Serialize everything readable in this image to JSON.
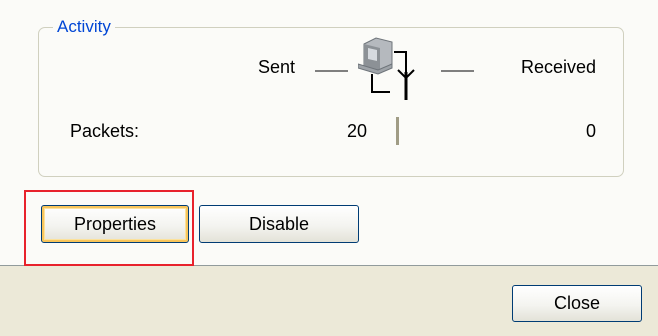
{
  "activity": {
    "title": "Activity",
    "sent_label": "Sent",
    "received_label": "Received",
    "packets_label": "Packets:",
    "packets_sent": "20",
    "packets_received": "0",
    "icon": "network-connection-icon"
  },
  "buttons": {
    "properties": "Properties",
    "disable": "Disable",
    "close": "Close"
  },
  "colors": {
    "group_title": "#0046D5",
    "dialog_bg": "#ECE9D8",
    "highlight": "#E8222C"
  }
}
